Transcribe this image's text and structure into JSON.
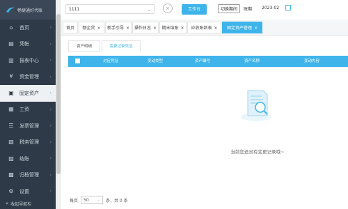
{
  "app": {
    "logo_text": "畅捷通好代账"
  },
  "sidebar": {
    "items": [
      {
        "icon": "home-icon",
        "glyph": "⌂",
        "label": "首页"
      },
      {
        "icon": "document-icon",
        "glyph": "▤",
        "label": "凭帐"
      },
      {
        "icon": "report-icon",
        "glyph": "▥",
        "label": "报表中心"
      },
      {
        "icon": "money-icon",
        "glyph": "¥",
        "label": "资金管理"
      },
      {
        "icon": "assets-icon",
        "glyph": "▣",
        "label": "固定资产",
        "active": true
      },
      {
        "icon": "payroll-icon",
        "glyph": "▦",
        "label": "工资"
      },
      {
        "icon": "invoice-icon",
        "glyph": "☰",
        "label": "发票管理"
      },
      {
        "icon": "tax-icon",
        "glyph": "▧",
        "label": "税务管理"
      },
      {
        "icon": "settlement-icon",
        "glyph": "▨",
        "label": "结账"
      },
      {
        "icon": "period-icon",
        "glyph": "▩",
        "label": "归档管理"
      },
      {
        "icon": "settings-icon",
        "glyph": "⚙",
        "label": "设置"
      }
    ],
    "bottom_label": "收起导航栏"
  },
  "topbar": {
    "account_value": "1111",
    "workbench_label": "工作台",
    "switch_label": "切换期间",
    "period_label": "账期",
    "period_value": "2023-02"
  },
  "tabs": [
    {
      "label": "首页"
    },
    {
      "label": "畅企贷"
    },
    {
      "label": "新手引导"
    },
    {
      "label": "操作日志"
    },
    {
      "label": "期末结账"
    },
    {
      "label": "应收账龄表"
    },
    {
      "label": "固定资产管理",
      "active": true
    }
  ],
  "subtabs": [
    {
      "label": "资产明细"
    },
    {
      "label": "变更记录凭证",
      "active": true
    }
  ],
  "table": {
    "columns": [
      "对应凭证",
      "变动类型",
      "资产编号",
      "资产名称",
      "变动内容"
    ]
  },
  "empty_text": "当前您还没有变更记录哦~",
  "pager": {
    "prefix": "每页",
    "page_size": "50",
    "suffix": "条，共 0 条"
  },
  "colors": {
    "accent": "#3eb4ea",
    "sidebar_bg": "#2e3a47"
  }
}
